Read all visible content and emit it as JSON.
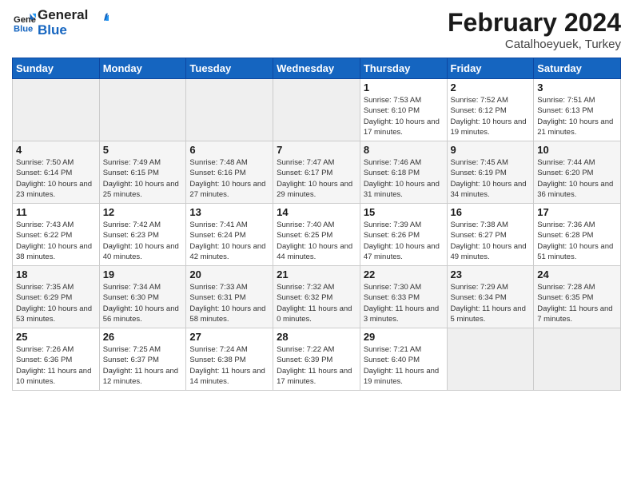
{
  "header": {
    "logo_general": "General",
    "logo_blue": "Blue",
    "title": "February 2024",
    "subtitle": "Catalhoeyuek, Turkey"
  },
  "days_of_week": [
    "Sunday",
    "Monday",
    "Tuesday",
    "Wednesday",
    "Thursday",
    "Friday",
    "Saturday"
  ],
  "weeks": [
    [
      {
        "day": "",
        "info": ""
      },
      {
        "day": "",
        "info": ""
      },
      {
        "day": "",
        "info": ""
      },
      {
        "day": "",
        "info": ""
      },
      {
        "day": "1",
        "info": "Sunrise: 7:53 AM\nSunset: 6:10 PM\nDaylight: 10 hours and 17 minutes."
      },
      {
        "day": "2",
        "info": "Sunrise: 7:52 AM\nSunset: 6:12 PM\nDaylight: 10 hours and 19 minutes."
      },
      {
        "day": "3",
        "info": "Sunrise: 7:51 AM\nSunset: 6:13 PM\nDaylight: 10 hours and 21 minutes."
      }
    ],
    [
      {
        "day": "4",
        "info": "Sunrise: 7:50 AM\nSunset: 6:14 PM\nDaylight: 10 hours and 23 minutes."
      },
      {
        "day": "5",
        "info": "Sunrise: 7:49 AM\nSunset: 6:15 PM\nDaylight: 10 hours and 25 minutes."
      },
      {
        "day": "6",
        "info": "Sunrise: 7:48 AM\nSunset: 6:16 PM\nDaylight: 10 hours and 27 minutes."
      },
      {
        "day": "7",
        "info": "Sunrise: 7:47 AM\nSunset: 6:17 PM\nDaylight: 10 hours and 29 minutes."
      },
      {
        "day": "8",
        "info": "Sunrise: 7:46 AM\nSunset: 6:18 PM\nDaylight: 10 hours and 31 minutes."
      },
      {
        "day": "9",
        "info": "Sunrise: 7:45 AM\nSunset: 6:19 PM\nDaylight: 10 hours and 34 minutes."
      },
      {
        "day": "10",
        "info": "Sunrise: 7:44 AM\nSunset: 6:20 PM\nDaylight: 10 hours and 36 minutes."
      }
    ],
    [
      {
        "day": "11",
        "info": "Sunrise: 7:43 AM\nSunset: 6:22 PM\nDaylight: 10 hours and 38 minutes."
      },
      {
        "day": "12",
        "info": "Sunrise: 7:42 AM\nSunset: 6:23 PM\nDaylight: 10 hours and 40 minutes."
      },
      {
        "day": "13",
        "info": "Sunrise: 7:41 AM\nSunset: 6:24 PM\nDaylight: 10 hours and 42 minutes."
      },
      {
        "day": "14",
        "info": "Sunrise: 7:40 AM\nSunset: 6:25 PM\nDaylight: 10 hours and 44 minutes."
      },
      {
        "day": "15",
        "info": "Sunrise: 7:39 AM\nSunset: 6:26 PM\nDaylight: 10 hours and 47 minutes."
      },
      {
        "day": "16",
        "info": "Sunrise: 7:38 AM\nSunset: 6:27 PM\nDaylight: 10 hours and 49 minutes."
      },
      {
        "day": "17",
        "info": "Sunrise: 7:36 AM\nSunset: 6:28 PM\nDaylight: 10 hours and 51 minutes."
      }
    ],
    [
      {
        "day": "18",
        "info": "Sunrise: 7:35 AM\nSunset: 6:29 PM\nDaylight: 10 hours and 53 minutes."
      },
      {
        "day": "19",
        "info": "Sunrise: 7:34 AM\nSunset: 6:30 PM\nDaylight: 10 hours and 56 minutes."
      },
      {
        "day": "20",
        "info": "Sunrise: 7:33 AM\nSunset: 6:31 PM\nDaylight: 10 hours and 58 minutes."
      },
      {
        "day": "21",
        "info": "Sunrise: 7:32 AM\nSunset: 6:32 PM\nDaylight: 11 hours and 0 minutes."
      },
      {
        "day": "22",
        "info": "Sunrise: 7:30 AM\nSunset: 6:33 PM\nDaylight: 11 hours and 3 minutes."
      },
      {
        "day": "23",
        "info": "Sunrise: 7:29 AM\nSunset: 6:34 PM\nDaylight: 11 hours and 5 minutes."
      },
      {
        "day": "24",
        "info": "Sunrise: 7:28 AM\nSunset: 6:35 PM\nDaylight: 11 hours and 7 minutes."
      }
    ],
    [
      {
        "day": "25",
        "info": "Sunrise: 7:26 AM\nSunset: 6:36 PM\nDaylight: 11 hours and 10 minutes."
      },
      {
        "day": "26",
        "info": "Sunrise: 7:25 AM\nSunset: 6:37 PM\nDaylight: 11 hours and 12 minutes."
      },
      {
        "day": "27",
        "info": "Sunrise: 7:24 AM\nSunset: 6:38 PM\nDaylight: 11 hours and 14 minutes."
      },
      {
        "day": "28",
        "info": "Sunrise: 7:22 AM\nSunset: 6:39 PM\nDaylight: 11 hours and 17 minutes."
      },
      {
        "day": "29",
        "info": "Sunrise: 7:21 AM\nSunset: 6:40 PM\nDaylight: 11 hours and 19 minutes."
      },
      {
        "day": "",
        "info": ""
      },
      {
        "day": "",
        "info": ""
      }
    ]
  ]
}
